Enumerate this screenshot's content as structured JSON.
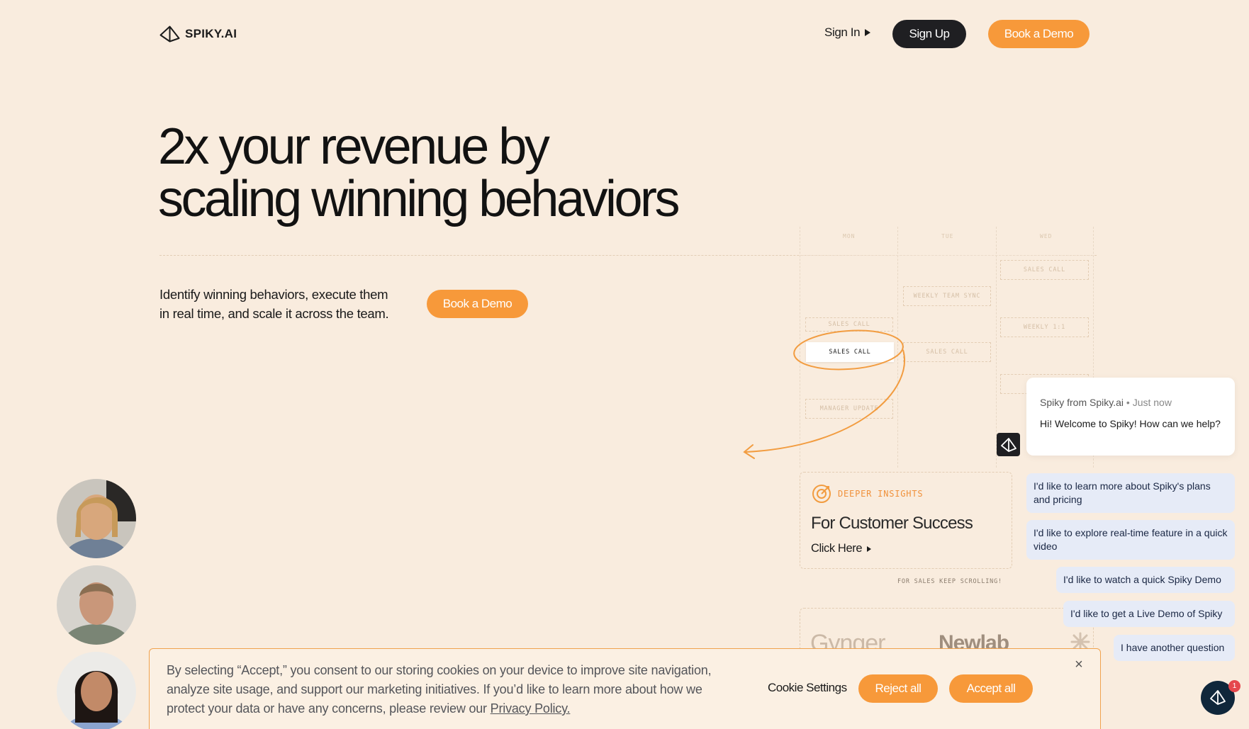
{
  "header": {
    "logo_text": "SPIKY.AI",
    "sign_in": "Sign In",
    "sign_up": "Sign Up",
    "book_demo": "Book a Demo"
  },
  "hero": {
    "title_line1": "2x your revenue by",
    "title_line2": "scaling winning behaviors",
    "subtitle": "Identify winning behaviors, execute them in real time, and scale it across the team.",
    "cta": "Book a Demo"
  },
  "calendar": {
    "days": [
      "MON",
      "TUE",
      "WED"
    ],
    "events": {
      "wed_sales_call": "SALES CALL",
      "weekly_team_sync": "WEEKLY TEAM SYNC",
      "mon_sales_call_ghost": "SALES CALL",
      "weekly_1_1": "WEEKLY 1:1",
      "mon_sales_call_active": "SALES CALL",
      "tue_sales_call": "SALES CALL",
      "manager_update": "MANAGER UPDATE"
    }
  },
  "insights": {
    "label": "DEEPER INSIGHTS",
    "title": "For Customer Success",
    "link": "Click Here"
  },
  "scroll_hint": "FOR SALES KEEP SCROLLING!",
  "logos": {
    "gynger": "Gynger",
    "newlab": "Newlab"
  },
  "chat": {
    "sender": "Spiky from Spiky.ai",
    "time": "Just now",
    "message": "Hi! Welcome to Spiky! How can we help?",
    "replies": [
      "I'd like to learn more about Spiky's plans and pricing",
      "I'd like to explore real-time feature in a quick video",
      "I'd like to watch a quick Spiky Demo",
      "I'd like to get a Live Demo of Spiky",
      "I have another question"
    ],
    "badge_count": "1"
  },
  "cookie": {
    "text": "By selecting “Accept,” you consent to our storing cookies on your device to improve site navigation, analyze site usage, and support our marketing initiatives. If you’d like to learn more about how we protect your data or have any concerns, please review our",
    "link": "Privacy Policy.",
    "settings": "Cookie Settings",
    "reject": "Reject all",
    "accept": "Accept all",
    "close": "×"
  },
  "colors": {
    "background": "#f9ecde",
    "accent_orange": "#f7993a",
    "dark_button": "#1f1f22",
    "chat_reply_bg": "#e6ebf7",
    "launcher": "#10273b"
  }
}
